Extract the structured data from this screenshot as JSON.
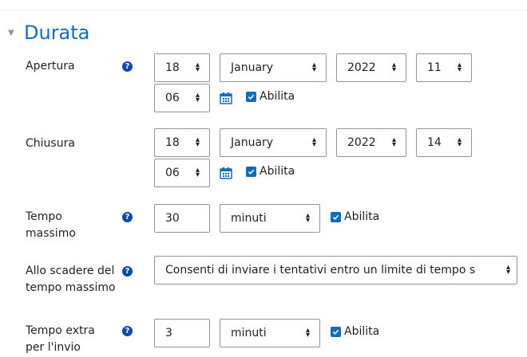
{
  "section": {
    "title": "Durata"
  },
  "apertura": {
    "label": "Apertura",
    "day": "18",
    "month": "January",
    "year": "2022",
    "hour": "11",
    "minute": "06",
    "enable_label": "Abilita",
    "enabled": true
  },
  "chiusura": {
    "label": "Chiusura",
    "day": "18",
    "month": "January",
    "year": "2022",
    "hour": "14",
    "minute": "06",
    "enable_label": "Abilita",
    "enabled": true
  },
  "tempo_massimo": {
    "label_line1": "Tempo",
    "label_line2": "massimo",
    "value": "30",
    "unit": "minuti",
    "enable_label": "Abilita",
    "enabled": true
  },
  "allo_scadere": {
    "label_line1": "Allo scadere del",
    "label_line2": "tempo massimo",
    "value": "Consenti di inviare i tentativi entro un limite di tempo s"
  },
  "tempo_extra": {
    "label_line1": "Tempo extra",
    "label_line2": "per l'invio",
    "value": "3",
    "unit": "minuti",
    "enable_label": "Abilita",
    "enabled": true
  },
  "colors": {
    "accent": "#0f6cbf",
    "help": "#0f47ad",
    "border": "#8f959e"
  }
}
